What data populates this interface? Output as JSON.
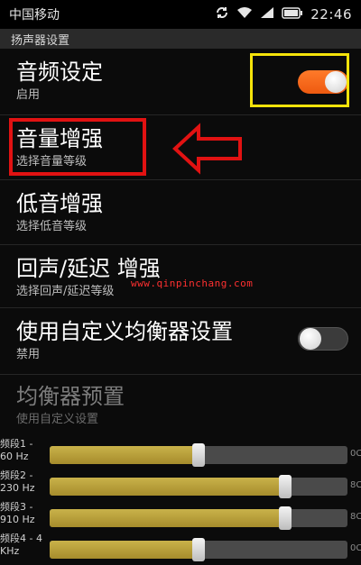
{
  "statusbar": {
    "carrier": "中国移动",
    "time": "22:46"
  },
  "section_header": "扬声器设置",
  "items": [
    {
      "title": "音频设定",
      "subtitle": "启用",
      "toggle": "on"
    },
    {
      "title": "音量增强",
      "subtitle": "选择音量等级"
    },
    {
      "title": "低音增强",
      "subtitle": "选择低音等级"
    },
    {
      "title": "回声/延迟 增强",
      "subtitle": "选择回声/延迟等级"
    },
    {
      "title": "使用自定义均衡器设置",
      "subtitle": "禁用",
      "toggle": "off"
    },
    {
      "title": "均衡器预置",
      "subtitle": "使用自定义设置",
      "disabled": true
    }
  ],
  "watermark": "www.qinpinchang.com",
  "bands": [
    {
      "label_line1": "频段1 -",
      "label_line2": "60 Hz",
      "level": 0.5,
      "max_label": "0C"
    },
    {
      "label_line1": "频段2 -",
      "label_line2": "230 Hz",
      "level": 0.79,
      "max_label": "8C"
    },
    {
      "label_line1": "频段3 -",
      "label_line2": "910 Hz",
      "level": 0.79,
      "max_label": "8C"
    },
    {
      "label_line1": "频段4 - 4",
      "label_line2": "KHz",
      "level": 0.5,
      "max_label": "0C"
    }
  ],
  "colors": {
    "toggle_on": "#ee5a10",
    "slider_fill": "#b89c38",
    "highlight_yellow": "#f5e30a",
    "highlight_red": "#e11212"
  }
}
